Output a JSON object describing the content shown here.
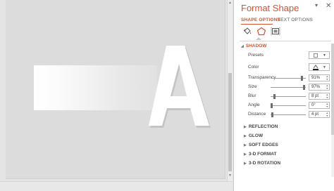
{
  "slide": {
    "letter": "A",
    "colors": {
      "letter": "#ffffff",
      "letter_shadow": "#c4c4c4",
      "slide_bg": "#dcdcdc",
      "gradient_start": "#ffffff",
      "gradient_end": "#e2e2e2"
    }
  },
  "pane": {
    "title": "Format Shape",
    "dropdown_icon": "chevron-down-icon",
    "close_icon": "close-icon",
    "tabs": [
      {
        "label": "SHAPE OPTIONS",
        "active": true
      },
      {
        "label": "TEXT OPTIONS",
        "active": false
      }
    ],
    "categories": [
      {
        "name": "fill-line",
        "icon": "paint-bucket-icon"
      },
      {
        "name": "effects",
        "icon": "pentagon-effects-icon",
        "active": true
      },
      {
        "name": "size-properties",
        "icon": "size-properties-icon"
      }
    ],
    "shadow": {
      "header": "SHADOW",
      "presets_label": "Presets",
      "color_label": "Color",
      "transparency_label": "Transparency",
      "transparency_value": "91%",
      "transparency_fraction": 0.91,
      "size_label": "Size",
      "size_value": "97%",
      "size_fraction": 0.97,
      "blur_label": "Blur",
      "blur_value": "8 pt",
      "blur_fraction": 0.08,
      "angle_label": "Angle",
      "angle_value": "0°",
      "angle_fraction": 0.0,
      "distance_label": "Distance",
      "distance_value": "4 pt",
      "distance_fraction": 0.02
    },
    "sections": [
      "REFLECTION",
      "GLOW",
      "SOFT EDGES",
      "3-D FORMAT",
      "3-D ROTATION"
    ],
    "accent_color": "#d35230"
  }
}
